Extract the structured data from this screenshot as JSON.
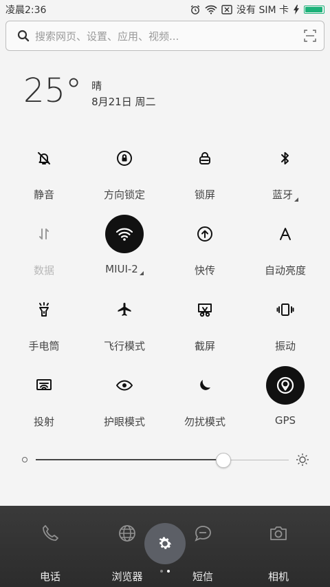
{
  "status_bar": {
    "time": "凌晨2:36",
    "carrier": "没有 SIM 卡",
    "battery_fraction": 0.95,
    "battery_color": "#1db179",
    "icons": [
      "alarm-icon",
      "wifi-icon",
      "sim-x-icon",
      "charging-icon",
      "battery-icon"
    ]
  },
  "search": {
    "placeholder": "搜索网页、设置、应用、视频...",
    "icons": [
      "search-icon",
      "scan-icon"
    ]
  },
  "weather": {
    "temperature": "25°",
    "condition": "晴",
    "date": "8月21日 周二"
  },
  "quick_settings": [
    {
      "label": "静音",
      "icon": "bell-mute-icon",
      "active": false,
      "disabled": false,
      "has_arrow": false
    },
    {
      "label": "方向锁定",
      "icon": "rotation-lock-icon",
      "active": false,
      "disabled": false,
      "has_arrow": false
    },
    {
      "label": "锁屏",
      "icon": "lock-icon",
      "active": false,
      "disabled": false,
      "has_arrow": false
    },
    {
      "label": "蓝牙",
      "icon": "bluetooth-icon",
      "active": false,
      "disabled": false,
      "has_arrow": true
    },
    {
      "label": "数据",
      "icon": "data-arrows-icon",
      "active": false,
      "disabled": true,
      "has_arrow": false
    },
    {
      "label": "MIUI-2",
      "icon": "wifi-icon",
      "active": true,
      "disabled": false,
      "has_arrow": true
    },
    {
      "label": "快传",
      "icon": "upload-circle-icon",
      "active": false,
      "disabled": false,
      "has_arrow": false
    },
    {
      "label": "自动亮度",
      "icon": "auto-brightness-icon",
      "active": false,
      "disabled": false,
      "has_arrow": false
    },
    {
      "label": "手电筒",
      "icon": "flashlight-icon",
      "active": false,
      "disabled": false,
      "has_arrow": false
    },
    {
      "label": "飞行模式",
      "icon": "airplane-icon",
      "active": false,
      "disabled": false,
      "has_arrow": false
    },
    {
      "label": "截屏",
      "icon": "screenshot-icon",
      "active": false,
      "disabled": false,
      "has_arrow": false
    },
    {
      "label": "振动",
      "icon": "vibrate-icon",
      "active": false,
      "disabled": false,
      "has_arrow": false
    },
    {
      "label": "投射",
      "icon": "cast-icon",
      "active": false,
      "disabled": false,
      "has_arrow": false
    },
    {
      "label": "护眼模式",
      "icon": "eye-icon",
      "active": false,
      "disabled": false,
      "has_arrow": false
    },
    {
      "label": "勿扰模式",
      "icon": "moon-icon",
      "active": false,
      "disabled": false,
      "has_arrow": false
    },
    {
      "label": "GPS",
      "icon": "gps-icon",
      "active": true,
      "disabled": false,
      "has_arrow": false
    }
  ],
  "brightness": {
    "level": 0.74,
    "icons": [
      "brightness-low-icon",
      "brightness-high-icon"
    ]
  },
  "dock": {
    "apps": [
      {
        "label": "电话",
        "icon": "phone-icon"
      },
      {
        "label": "浏览器",
        "icon": "globe-icon"
      },
      {
        "label": "短信",
        "icon": "message-icon"
      },
      {
        "label": "相机",
        "icon": "camera-icon"
      }
    ],
    "settings_icon": "gear-icon",
    "pages": 2,
    "current_page": 2
  }
}
